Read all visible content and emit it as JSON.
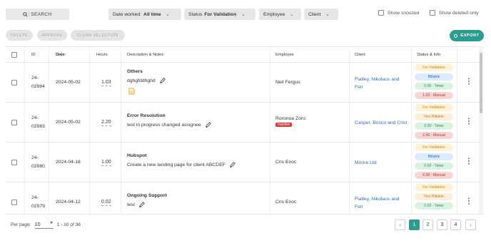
{
  "toolbar": {
    "search_label": "SEARCH",
    "filters": [
      {
        "label": "Date worked:",
        "value": "All time"
      },
      {
        "label": "Status",
        "value": "For Validation"
      },
      {
        "label": "Employee",
        "value": ""
      },
      {
        "label": "Client",
        "value": ""
      }
    ],
    "show_snoozed": "Show snoozed",
    "show_deleted": "Show deleted only"
  },
  "actions": {
    "delete": "DELETE",
    "approve": "APPROVE",
    "clear": "CLEAR SELECTION",
    "export": "EXPORT"
  },
  "table": {
    "headers": {
      "id": "ID",
      "date": "Date",
      "date_sort": "↑",
      "hours": "Hours",
      "desc": "Description & Notes",
      "employee": "Employee",
      "client": "Client",
      "status": "Status & Info"
    },
    "rows": [
      {
        "id_a": "24-",
        "id_b": "02984",
        "date": "2024-05-02",
        "hours": "1.03",
        "title": "Others",
        "desc": "dghgfddhghd",
        "employee": "Neil Fergus",
        "employee_badge": "",
        "client_a": "Flatley, Nikolaus and",
        "client_b": "Feil",
        "status": [
          "For Validation",
          "Billable",
          "0.00 - Timer",
          "1.03 - Manual"
        ]
      },
      {
        "id_a": "24-",
        "id_b": "02983",
        "date": "2024-05-02",
        "hours": "2.20",
        "title": "Error Resolution",
        "desc": "test in progress changed assignee",
        "employee": "Roronoa Zoro",
        "employee_badge": "Inactive",
        "client_a": "Casper, Bosco and Crist",
        "client_b": "",
        "status": [
          "For Validation",
          "Non Billable",
          "0.20 - Timer",
          "2.00 - Manual"
        ]
      },
      {
        "id_a": "24-",
        "id_b": "02980",
        "date": "2024-04-18",
        "hours": "1.00",
        "title": "Hubspot",
        "desc": "Create a new landing page for client ABCDEF",
        "employee": "Cris Enoc",
        "employee_badge": "",
        "client_a": "Moore Ltd",
        "client_b": "",
        "status": [
          "For Validation",
          "Billable",
          "0.02 - Timer",
          "0.98 - Manual"
        ]
      },
      {
        "id_a": "24-",
        "id_b": "02979",
        "date": "2024-04-12",
        "hours": "0.02",
        "title": "Ongoing Support",
        "desc": "test",
        "employee": "Cris Enoc",
        "employee_badge": "",
        "client_a": "Flatley, Nikolaus and",
        "client_b": "Feil",
        "status": [
          "For Validation",
          "Non Billable",
          "0.02 - Timer",
          ""
        ]
      }
    ]
  },
  "footer": {
    "per_page_label": "Per page:",
    "per_page_value": "10",
    "range": "1 - 10 of 36",
    "pages": [
      "1",
      "2",
      "3",
      "4"
    ],
    "current_page": "1"
  },
  "colors": {
    "accent": "#2a9d8f",
    "link": "#2f6db5",
    "inactive": "#d73a3a"
  }
}
